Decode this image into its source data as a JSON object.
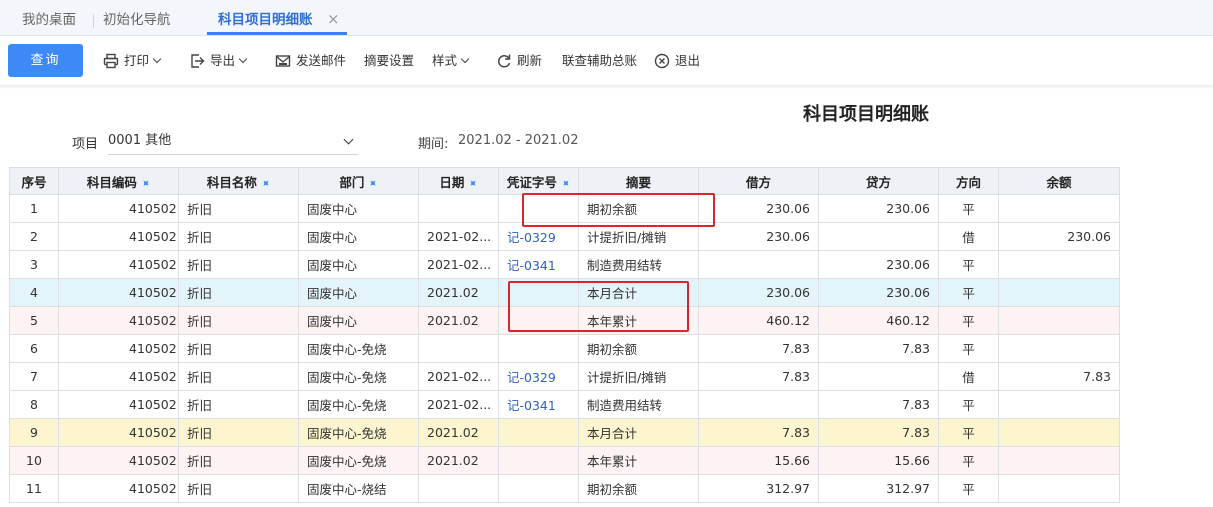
{
  "tabs": {
    "desktop": "我的桌面",
    "init_nav": "初始化导航",
    "active": "科目项目明细账",
    "close": "×"
  },
  "toolbar": {
    "query": "查询",
    "print": "打印",
    "export": "导出",
    "send_mail": "发送邮件",
    "summary_settings": "摘要设置",
    "style": "样式",
    "refresh": "刷新",
    "aux_ledger": "联查辅助总账",
    "exit": "退出"
  },
  "report": {
    "title": "科目项目明细账",
    "project_label": "项目",
    "project_value": "0001 其他",
    "period_label": "期间:",
    "period_value": "2021.02 - 2021.02"
  },
  "table": {
    "headers": [
      "序号",
      "科目编码",
      "科目名称",
      "部门",
      "日期",
      "凭证字号",
      "摘要",
      "借方",
      "贷方",
      "方向",
      "余额"
    ],
    "rows": [
      [
        "1",
        "410502",
        "折旧",
        "固废中心",
        "",
        "",
        "期初余额",
        "230.06",
        "230.06",
        "平",
        ""
      ],
      [
        "2",
        "410502",
        "折旧",
        "固废中心",
        "2021-02...",
        "记-0329",
        "计提折旧/摊销",
        "230.06",
        "",
        "借",
        "230.06"
      ],
      [
        "3",
        "410502",
        "折旧",
        "固废中心",
        "2021-02...",
        "记-0341",
        "制造费用结转",
        "",
        "230.06",
        "平",
        ""
      ],
      [
        "4",
        "410502",
        "折旧",
        "固废中心",
        "2021.02",
        "",
        "本月合计",
        "230.06",
        "230.06",
        "平",
        ""
      ],
      [
        "5",
        "410502",
        "折旧",
        "固废中心",
        "2021.02",
        "",
        "本年累计",
        "460.12",
        "460.12",
        "平",
        ""
      ],
      [
        "6",
        "410502",
        "折旧",
        "固废中心-免烧",
        "",
        "",
        "期初余额",
        "7.83",
        "7.83",
        "平",
        ""
      ],
      [
        "7",
        "410502",
        "折旧",
        "固废中心-免烧",
        "2021-02...",
        "记-0329",
        "计提折旧/摊销",
        "7.83",
        "",
        "借",
        "7.83"
      ],
      [
        "8",
        "410502",
        "折旧",
        "固废中心-免烧",
        "2021-02...",
        "记-0341",
        "制造费用结转",
        "",
        "7.83",
        "平",
        ""
      ],
      [
        "9",
        "410502",
        "折旧",
        "固废中心-免烧",
        "2021.02",
        "",
        "本月合计",
        "7.83",
        "7.83",
        "平",
        ""
      ],
      [
        "10",
        "410502",
        "折旧",
        "固废中心-免烧",
        "2021.02",
        "",
        "本年累计",
        "15.66",
        "15.66",
        "平",
        ""
      ],
      [
        "11",
        "410502",
        "折旧",
        "固废中心-烧结",
        "",
        "",
        "期初余额",
        "312.97",
        "312.97",
        "平",
        ""
      ]
    ]
  },
  "colors": {
    "accent": "#3d8af7",
    "month_total_row": "#e4f4fb",
    "year_total_row": "#fdf3f3",
    "month_total_row_alt": "#fdf5cf",
    "annotation": "#d9262c"
  },
  "icons": [
    "print-icon",
    "export-icon",
    "mail-icon",
    "refresh-icon",
    "exit-icon",
    "pin-icon",
    "close-icon",
    "chevron-down-icon"
  ]
}
